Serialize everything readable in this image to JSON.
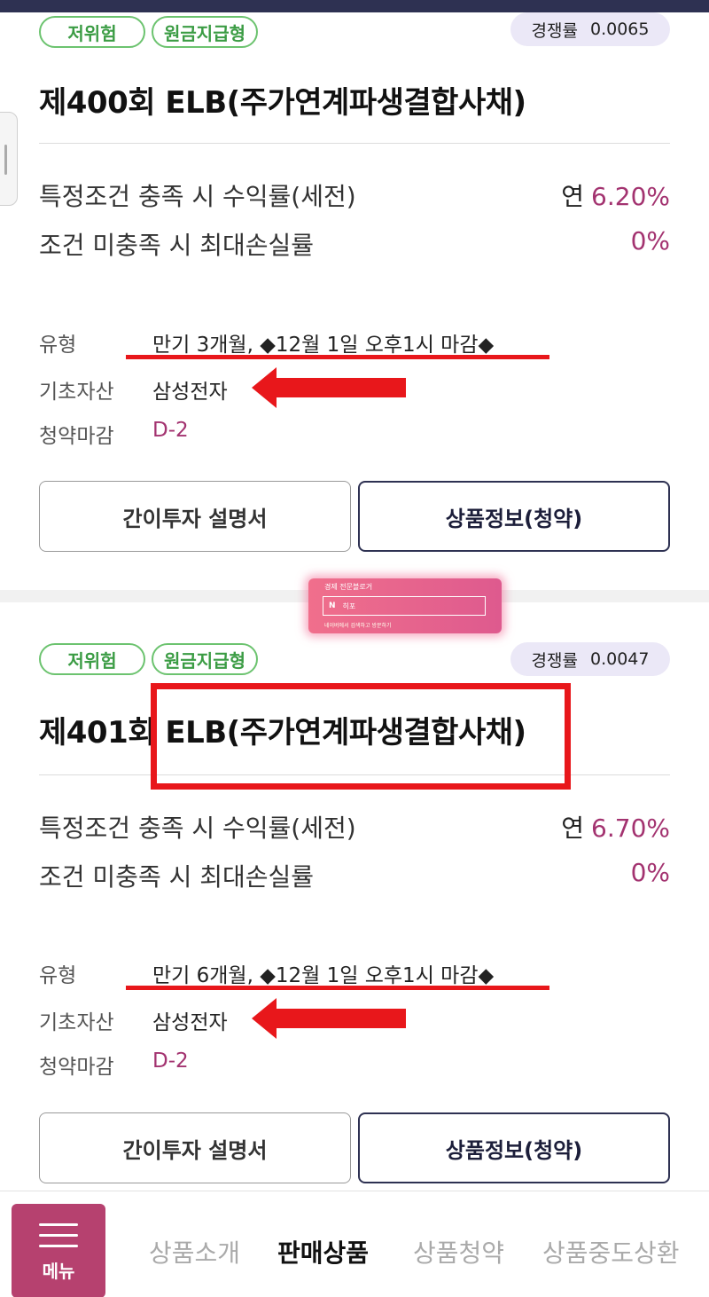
{
  "colors": {
    "accent_pink": "#a33370",
    "navy": "#2e3152",
    "green_badge": "#6cc36f",
    "annotation_red": "#e8171b",
    "menu_bg": "#b6416f"
  },
  "products": [
    {
      "badges": [
        "저위험",
        "원금지급형"
      ],
      "competition_label": "경쟁률",
      "competition_value": "0.0065",
      "title": "제400회 ELB(주가연계파생결합사채)",
      "return_label": "특정조건 충족 시 수익률(세전)",
      "return_prefix": "연",
      "return_value": "6.20%",
      "loss_label": "조건 미충족 시 최대손실률",
      "loss_value": "0%",
      "type_label": "유형",
      "type_value": "만기 3개월, ◆12월 1일 오후1시 마감◆",
      "asset_label": "기초자산",
      "asset_value": "삼성전자",
      "deadline_label": "청약마감",
      "deadline_value": "D-2",
      "guide_button": "간이투자 설명서",
      "info_button": "상품정보(청약)"
    },
    {
      "badges": [
        "저위험",
        "원금지급형"
      ],
      "competition_label": "경쟁률",
      "competition_value": "0.0047",
      "title": "제401회 ELB(주가연계파생결합사채)",
      "return_label": "특정조건 충족 시 수익률(세전)",
      "return_prefix": "연",
      "return_value": "6.70%",
      "loss_label": "조건 미충족 시 최대손실률",
      "loss_value": "0%",
      "type_label": "유형",
      "type_value": "만기 6개월, ◆12월 1일 오후1시 마감◆",
      "asset_label": "기초자산",
      "asset_value": "삼성전자",
      "deadline_label": "청약마감",
      "deadline_value": "D-2",
      "guide_button": "간이투자 설명서",
      "info_button": "상품정보(청약)"
    }
  ],
  "ad": {
    "title": "경제 전문블로거",
    "logo": "N",
    "search_text": "히포",
    "footer": "네이버에서 검색하고 방문하기"
  },
  "bottom_nav": {
    "menu_label": "메뉴",
    "items": [
      "상품소개",
      "판매상품",
      "상품청약",
      "상품중도상환"
    ],
    "active_index": 1
  }
}
